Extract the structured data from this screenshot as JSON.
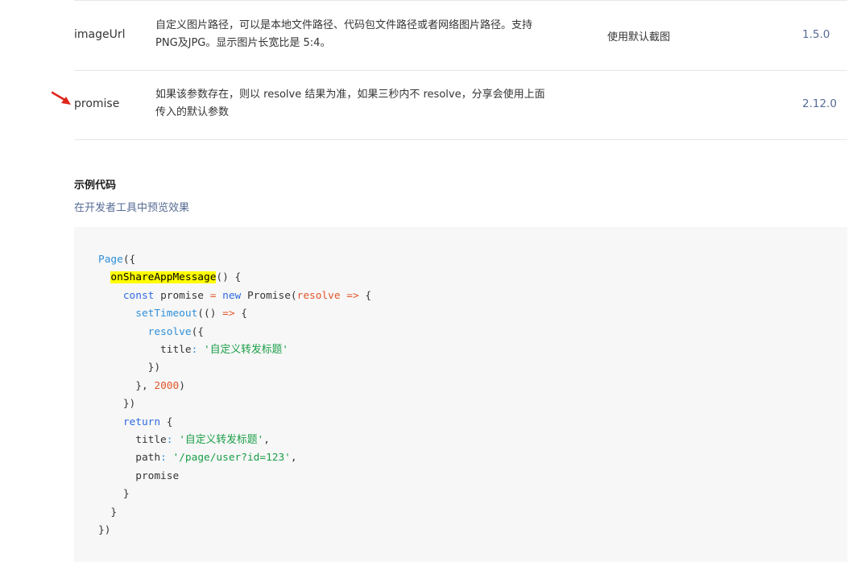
{
  "params": [
    {
      "name": "imageUrl",
      "desc_line1": "自定义图片路径，可以是本地文件路径、代码包文件路径或者网络图片路径。支持",
      "desc_line2": "PNG及JPG。显示图片长宽比是 5:4。",
      "default": "使用默认截图",
      "version": "1.5.0"
    },
    {
      "name": "promise",
      "desc_line1": "如果该参数存在，则以 resolve 结果为准，如果三秒内不 resolve，分享会使用上面",
      "desc_line2": "传入的默认参数",
      "default": "",
      "version": "2.12.0"
    }
  ],
  "example": {
    "title": "示例代码",
    "preview_link": "在开发者工具中预览效果"
  },
  "code": {
    "l1_page": "Page",
    "l1_open": "({",
    "l2_fn": "onShareAppMessage",
    "l2_rest": "() {",
    "l3_const": "const",
    "l3_var": " promise ",
    "l3_eq": "=",
    "l3_new": "new",
    "l3_promise": " Promise(",
    "l3_param": "resolve",
    "l3_arrow": "=>",
    "l3_brace": " {",
    "l4_fn": "setTimeout",
    "l4_mid": "(() ",
    "l4_arrow": "=>",
    "l4_brace": " {",
    "l5_fn": "resolve",
    "l5_rest": "({",
    "l6_key": "title",
    "l6_colon": ":",
    "l6_str": "'自定义转发标题'",
    "l7": "})",
    "l8_start": "}, ",
    "l8_num": "2000",
    "l8_end": ")",
    "l9": "})",
    "l10_kw": "return",
    "l10_brace": " {",
    "l11_key": "title",
    "l11_colon": ":",
    "l11_str": "'自定义转发标题'",
    "l11_comma": ",",
    "l12_key": "path",
    "l12_colon": ":",
    "l12_str": "'/page/user?id=123'",
    "l12_comma": ",",
    "l13": "promise",
    "l14": "}",
    "l15": "}",
    "l16": "})"
  },
  "colors": {
    "link": "#576b95",
    "keyword": "#2f6be0",
    "string": "#1a9e47",
    "number": "#e2562b",
    "highlight": "#ffff00",
    "arrow": "#e0261b"
  }
}
